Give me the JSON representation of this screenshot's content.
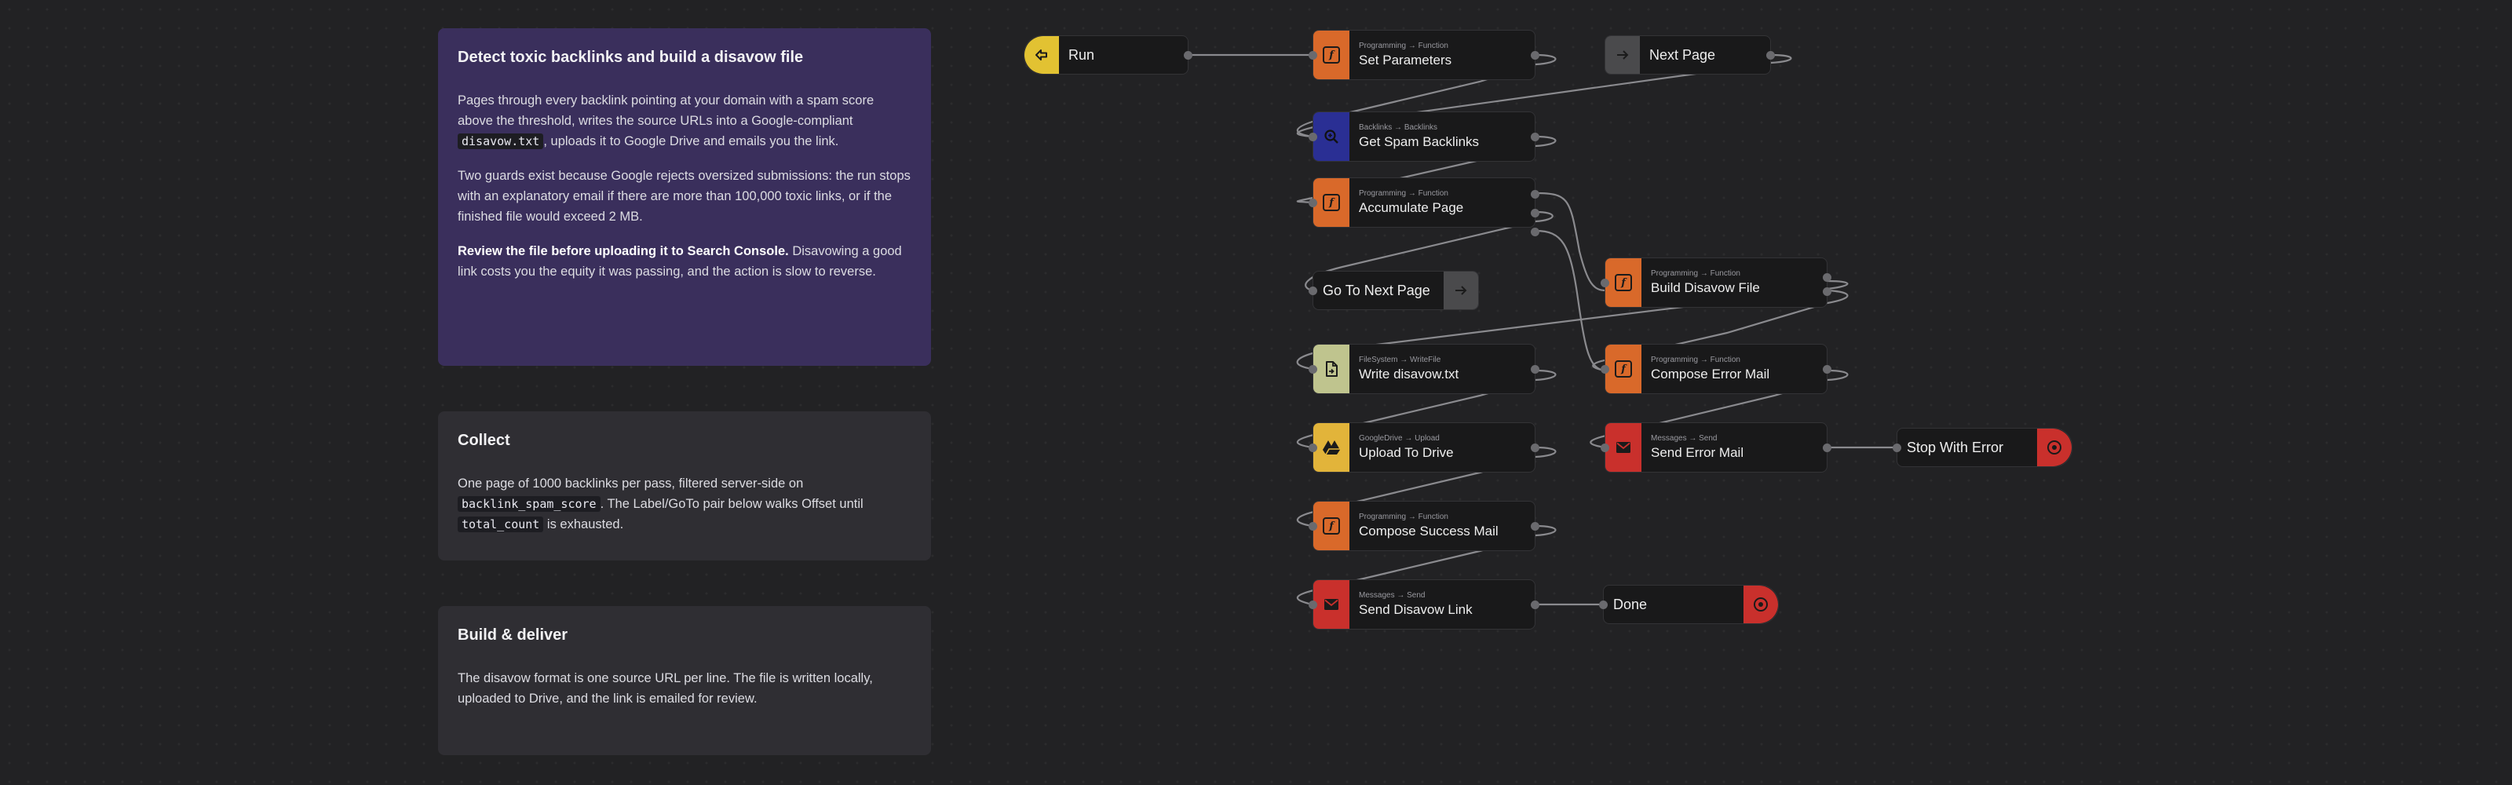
{
  "colors": {
    "background": "#222224",
    "note_purple": "#3a2f5c",
    "note_gray": "#2f2e33",
    "programming": "#d9692a",
    "backlinks": "#2a2f94",
    "filesystem": "#bfc48e",
    "googledrive": "#e2b43a",
    "messages": "#c9302c",
    "trigger": "#e2c232",
    "goto": "#4a4a4c"
  },
  "notes": {
    "intro": {
      "title": "Detect toxic backlinks and build a disavow file",
      "p1_before": "Pages through every backlink pointing at your domain with a spam score above the threshold, writes the source URLs into a Google-compliant ",
      "p1_code": "disavow.txt",
      "p1_after": ", uploads it to Google Drive and emails you the link.",
      "p2": "Two guards exist because Google rejects oversized submissions: the run stops with an explanatory email if there are more than 100,000 toxic links, or if the finished file would exceed 2 MB.",
      "p3_bold": "Review the file before uploading it to Search Console.",
      "p3_rest": " Disavowing a good link costs you the equity it was passing, and the action is slow to reverse."
    },
    "collect": {
      "title": "Collect",
      "p_before": "One page of 1000 backlinks per pass, filtered server-side on ",
      "code1": "backlink_spam_score",
      "p_mid": ". The Label/GoTo pair below walks Offset until ",
      "code2": "total_count",
      "p_after": " is exhausted."
    },
    "deliver": {
      "title": "Build & deliver",
      "p": "The disavow format is one source URL per line. The file is written locally, uploaded to Drive, and the link is emailed for review."
    }
  },
  "nodes": {
    "run": {
      "title": "Run",
      "icon": "trigger-icon"
    },
    "set_parameters": {
      "category": "Programming",
      "action": "Function",
      "title": "Set Parameters",
      "icon": "function-icon"
    },
    "next_page": {
      "title": "Next Page",
      "icon": "label-arrow-icon"
    },
    "get_spam_backlinks": {
      "category": "Backlinks",
      "action": "Backlinks",
      "title": "Get Spam Backlinks",
      "icon": "magnifier-icon"
    },
    "accumulate_page": {
      "category": "Programming",
      "action": "Function",
      "title": "Accumulate Page",
      "icon": "function-icon"
    },
    "go_to_next_page": {
      "title": "Go To Next Page",
      "icon": "goto-arrow-icon"
    },
    "build_disavow_file": {
      "category": "Programming",
      "action": "Function",
      "title": "Build Disavow File",
      "icon": "function-icon"
    },
    "write_disavow": {
      "category": "FileSystem",
      "action": "WriteFile",
      "title": "Write disavow.txt",
      "icon": "file-write-icon"
    },
    "compose_error_mail": {
      "category": "Programming",
      "action": "Function",
      "title": "Compose Error Mail",
      "icon": "function-icon"
    },
    "upload_to_drive": {
      "category": "GoogleDrive",
      "action": "Upload",
      "title": "Upload To Drive",
      "icon": "drive-icon"
    },
    "send_error_mail": {
      "category": "Messages",
      "action": "Send",
      "title": "Send Error Mail",
      "icon": "mail-icon"
    },
    "stop_with_error": {
      "title": "Stop With Error",
      "icon": "stop-target-icon"
    },
    "compose_success_mail": {
      "category": "Programming",
      "action": "Function",
      "title": "Compose Success Mail",
      "icon": "function-icon"
    },
    "send_disavow_link": {
      "category": "Messages",
      "action": "Send",
      "title": "Send Disavow Link",
      "icon": "mail-icon"
    },
    "done": {
      "title": "Done",
      "icon": "stop-target-icon"
    }
  },
  "arrow": "→"
}
